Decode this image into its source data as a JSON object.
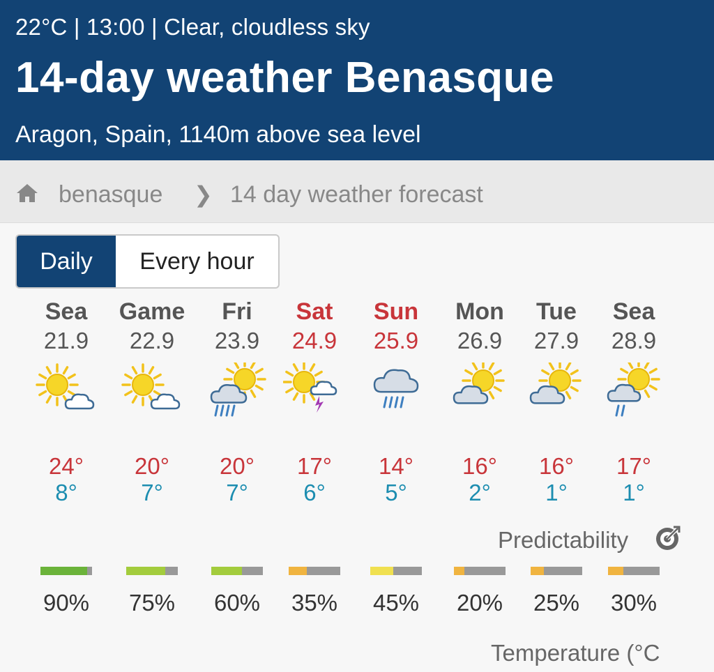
{
  "header": {
    "status": "22°C | 13:00 | Clear, cloudless sky",
    "title": "14-day weather Benasque",
    "location": "Aragon, Spain, 1140m above sea level"
  },
  "breadcrumb": {
    "home": "benasque",
    "separator": "❯",
    "current": "14 day weather forecast"
  },
  "view_toggle": {
    "daily": "Daily",
    "hourly": "Every hour",
    "selected": "Daily"
  },
  "days": [
    {
      "name": "Sea",
      "date": "21.9",
      "weekend": false,
      "icon": "sun-cloud-icon",
      "max": "24°",
      "min": "8°"
    },
    {
      "name": "Game",
      "date": "22.9",
      "weekend": false,
      "icon": "sun-cloud-icon",
      "max": "20°",
      "min": "7°"
    },
    {
      "name": "Fri",
      "date": "23.9",
      "weekend": false,
      "icon": "sun-rain-cloud-icon",
      "max": "20°",
      "min": "7°"
    },
    {
      "name": "Sat",
      "date": "24.9",
      "weekend": true,
      "icon": "sun-thunder-icon",
      "max": "17°",
      "min": "6°"
    },
    {
      "name": "Sun",
      "date": "25.9",
      "weekend": true,
      "icon": "rain-cloud-icon",
      "max": "14°",
      "min": "5°"
    },
    {
      "name": "Mon",
      "date": "26.9",
      "weekend": false,
      "icon": "cloud-sun-icon",
      "max": "16°",
      "min": "2°"
    },
    {
      "name": "Tue",
      "date": "27.9",
      "weekend": false,
      "icon": "cloud-sun-icon",
      "max": "16°",
      "min": "1°"
    },
    {
      "name": "Sea",
      "date": "28.9",
      "weekend": false,
      "icon": "sun-drizzle-cloud-icon",
      "max": "17°",
      "min": "1°"
    }
  ],
  "predictability": {
    "label": "Predictability",
    "icon": "predictability-target-icon",
    "values": [
      {
        "pct": "90%",
        "fraction": 0.9,
        "color": "#6bb33a"
      },
      {
        "pct": "75%",
        "fraction": 0.75,
        "color": "#a3cc3d"
      },
      {
        "pct": "60%",
        "fraction": 0.6,
        "color": "#a3cc3d"
      },
      {
        "pct": "35%",
        "fraction": 0.35,
        "color": "#f0b440"
      },
      {
        "pct": "45%",
        "fraction": 0.45,
        "color": "#f0e050"
      },
      {
        "pct": "20%",
        "fraction": 0.2,
        "color": "#f0b440"
      },
      {
        "pct": "25%",
        "fraction": 0.25,
        "color": "#f0b440"
      },
      {
        "pct": "30%",
        "fraction": 0.3,
        "color": "#f0b440"
      }
    ]
  },
  "section_heading": "Temperature (°C",
  "colors": {
    "header_bg": "#124374",
    "weekend_red": "#c8353a",
    "min_temp_blue": "#1c8db0"
  }
}
